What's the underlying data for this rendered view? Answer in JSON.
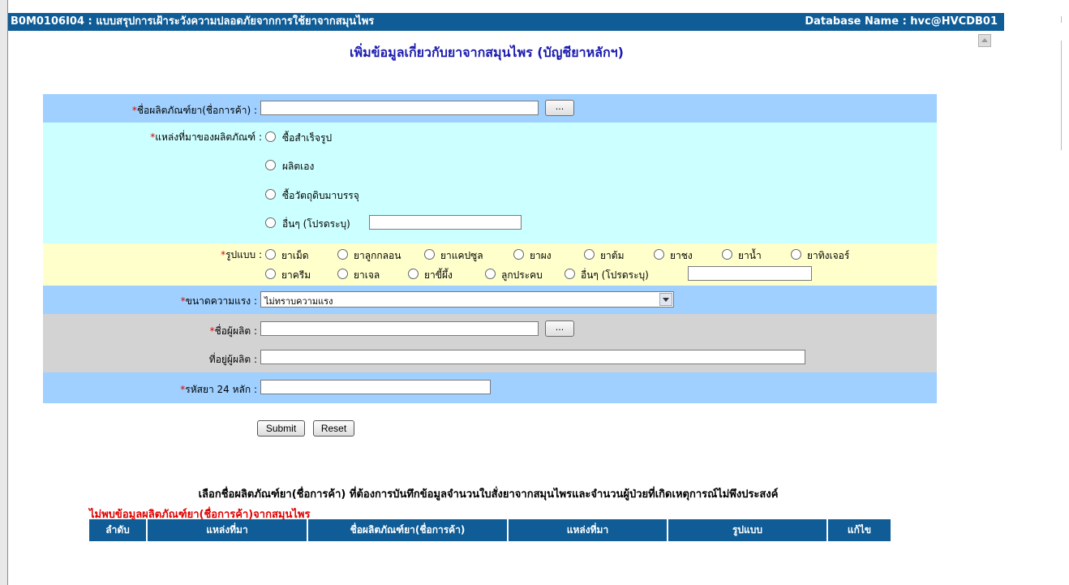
{
  "header": {
    "form_code": "B0M0106I04 : แบบสรุปการเฝ้าระวังความปลอดภัยจากการใช้ยาจากสมุนไพร",
    "database": "Database Name : hvc@HVCDB01"
  },
  "page_title": "เพิ่มข้อมูลเกี่ยวกับยาจากสมุนไพร (บัญชียาหลักฯ)",
  "form": {
    "required_mark": "*",
    "product_name_label": "ชื่อผลิตภัณฑ์ยา(ชื่อการค้า) :",
    "product_name_value": "",
    "lookup_button": "...",
    "source_label": "แหล่งที่มาของผลิตภัณฑ์ :",
    "source_options": [
      "ซื้อสำเร็จรูป",
      "ผลิตเอง",
      "ซื้อวัตถุดิบมาบรรจุ",
      "อื่นๆ  (โปรดระบุ)"
    ],
    "form_label": "รูปแบบ :",
    "form_options_row1": [
      "ยาเม็ด",
      "ยาลูกกลอน",
      "ยาแคปซูล",
      "ยาผง",
      "ยาต้ม",
      "ยาชง",
      "ยาน้ำ",
      "ยาทิงเจอร์"
    ],
    "form_options_row2": [
      "ยาครีม",
      "ยาเจล",
      "ยาขี้ผึ้ง",
      "ลูกประคบ",
      "อื่นๆ  (โปรดระบุ)"
    ],
    "strength_label": "ขนาดความแรง :",
    "strength_value": "ไม่ทราบความแรง",
    "manufacturer_label": "ชื่อผู้ผลิต :",
    "manufacturer_address_label": "ที่อยู่ผู้ผลิต :",
    "drug_code_label": "รหัสยา 24 หลัก :",
    "submit": "Submit",
    "reset": "Reset"
  },
  "list": {
    "title": "เลือกชื่อผลิตภัณฑ์ยา(ชื่อการค้า) ที่ต้องการบันทึกข้อมูลจำนวนใบสั่งยาจากสมุนไพรและจำนวนผู้ป่วยที่เกิดเหตุการณ์ไม่พึงประสงค์",
    "not_found": "ไม่พบข้อมูลผลิตภัณฑ์ยา(ชื่อการค้า)จากสมุนไพร",
    "columns": [
      "ลำดับ",
      "แหล่งที่มา",
      "ชื่อผลิตภัณฑ์ยา(ชื่อการค้า)",
      "แหล่งที่มา",
      "รูปแบบ",
      "แก้ไข"
    ]
  },
  "colors": {
    "header_bg": "#0f5c96",
    "row_blue": "#9fd0ff",
    "row_cyan": "#ccffff",
    "row_yellow": "#ffffcc",
    "row_gray": "#d3d3d3",
    "required": "#e00000"
  }
}
